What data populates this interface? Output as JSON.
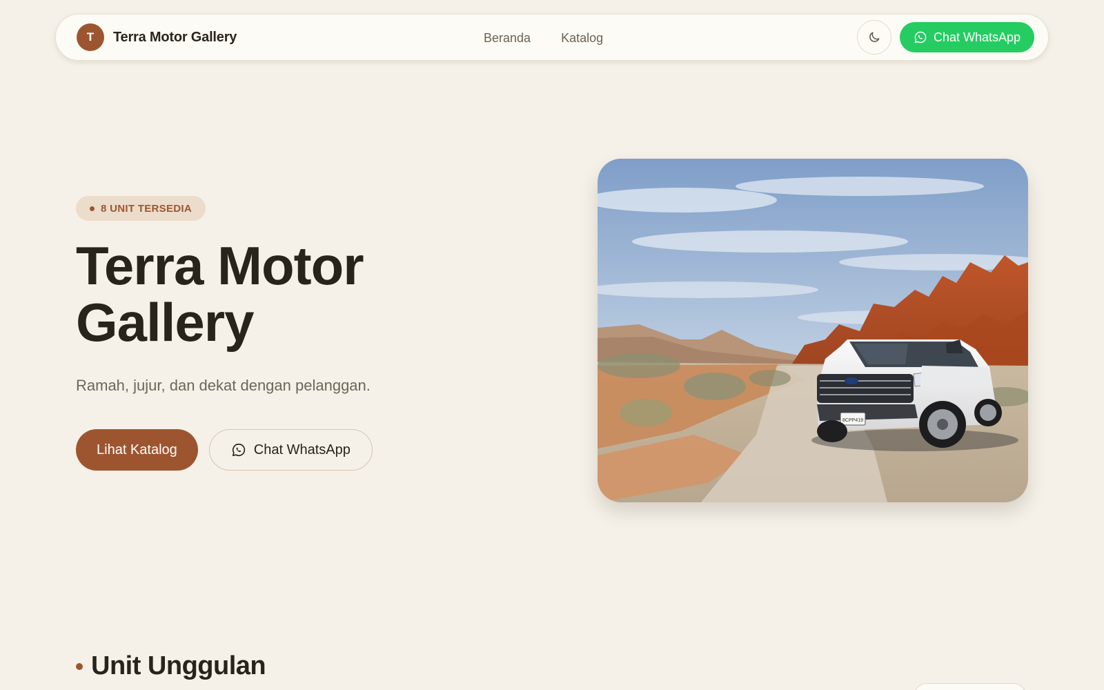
{
  "nav": {
    "logo_letter": "T",
    "brand": "Terra Motor Gallery",
    "links": [
      {
        "label": "Beranda"
      },
      {
        "label": "Katalog"
      }
    ],
    "theme_toggle_icon": "moon-icon",
    "whatsapp_label": "Chat WhatsApp",
    "whatsapp_color": "#25cc62"
  },
  "hero": {
    "badge": "8 UNIT TERSEDIA",
    "title_line1": "Terra Motor",
    "title_line2": "Gallery",
    "subtitle": "Ramah, jujur, dan dekat dengan pelanggan.",
    "primary_cta": "Lihat Katalog",
    "secondary_cta": "Chat WhatsApp",
    "image_plate": "8CPP419"
  },
  "section": {
    "title": "Unit Unggulan"
  },
  "colors": {
    "accent": "#9d5530",
    "background": "#f5f1e8",
    "whatsapp": "#25cc62"
  }
}
